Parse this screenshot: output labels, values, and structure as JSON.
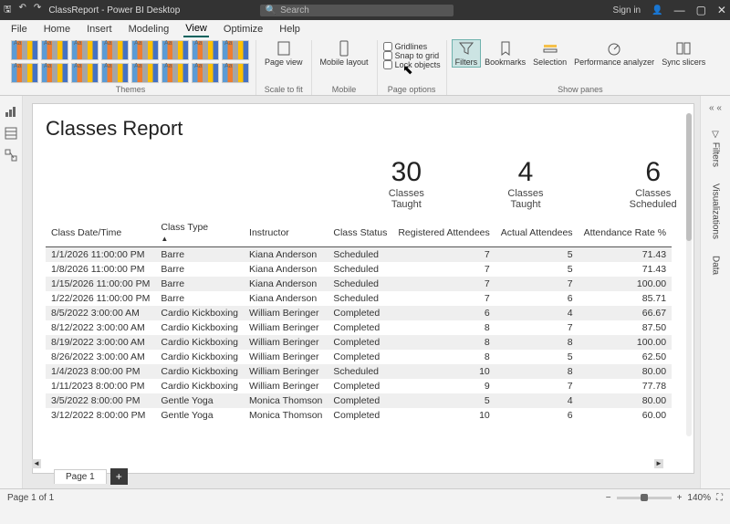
{
  "titlebar": {
    "title": "ClassReport - Power BI Desktop",
    "search_placeholder": "Search",
    "signin": "Sign in"
  },
  "menu": {
    "file": "File",
    "home": "Home",
    "insert": "Insert",
    "modeling": "Modeling",
    "view": "View",
    "optimize": "Optimize",
    "help": "Help"
  },
  "ribbon": {
    "themes_label": "Themes",
    "pageview": "Page view",
    "scale_label": "Scale to fit",
    "mobile": "Mobile layout",
    "mobile_label": "Mobile",
    "gridlines": "Gridlines",
    "snap": "Snap to grid",
    "lock": "Lock objects",
    "pageopts_label": "Page options",
    "filters": "Filters",
    "bookmarks": "Bookmarks",
    "selection": "Selection",
    "perf": "Performance analyzer",
    "sync": "Sync slicers",
    "panes_label": "Show panes"
  },
  "rightpanes": {
    "filters": "Filters",
    "visualizations": "Visualizations",
    "data": "Data"
  },
  "report": {
    "title": "Classes Report",
    "cards": [
      {
        "num": "30",
        "lbl": "Classes Taught"
      },
      {
        "num": "4",
        "lbl": "Classes Taught"
      },
      {
        "num": "6",
        "lbl": "Classes Scheduled"
      }
    ],
    "headers": {
      "dt": "Class Date/Time",
      "type": "Class Type",
      "instr": "Instructor",
      "status": "Class Status",
      "reg": "Registered Attendees",
      "act": "Actual Attendees",
      "rate": "Attendance Rate %"
    },
    "rows": [
      {
        "dt": "1/1/2026 11:00:00 PM",
        "type": "Barre",
        "instr": "Kiana Anderson",
        "status": "Scheduled",
        "reg": "7",
        "act": "5",
        "rate": "71.43"
      },
      {
        "dt": "1/8/2026 11:00:00 PM",
        "type": "Barre",
        "instr": "Kiana Anderson",
        "status": "Scheduled",
        "reg": "7",
        "act": "5",
        "rate": "71.43"
      },
      {
        "dt": "1/15/2026 11:00:00 PM",
        "type": "Barre",
        "instr": "Kiana Anderson",
        "status": "Scheduled",
        "reg": "7",
        "act": "7",
        "rate": "100.00"
      },
      {
        "dt": "1/22/2026 11:00:00 PM",
        "type": "Barre",
        "instr": "Kiana Anderson",
        "status": "Scheduled",
        "reg": "7",
        "act": "6",
        "rate": "85.71"
      },
      {
        "dt": "8/5/2022 3:00:00 AM",
        "type": "Cardio Kickboxing",
        "instr": "William Beringer",
        "status": "Completed",
        "reg": "6",
        "act": "4",
        "rate": "66.67"
      },
      {
        "dt": "8/12/2022 3:00:00 AM",
        "type": "Cardio Kickboxing",
        "instr": "William Beringer",
        "status": "Completed",
        "reg": "8",
        "act": "7",
        "rate": "87.50"
      },
      {
        "dt": "8/19/2022 3:00:00 AM",
        "type": "Cardio Kickboxing",
        "instr": "William Beringer",
        "status": "Completed",
        "reg": "8",
        "act": "8",
        "rate": "100.00"
      },
      {
        "dt": "8/26/2022 3:00:00 AM",
        "type": "Cardio Kickboxing",
        "instr": "William Beringer",
        "status": "Completed",
        "reg": "8",
        "act": "5",
        "rate": "62.50"
      },
      {
        "dt": "1/4/2023 8:00:00 PM",
        "type": "Cardio Kickboxing",
        "instr": "William Beringer",
        "status": "Scheduled",
        "reg": "10",
        "act": "8",
        "rate": "80.00"
      },
      {
        "dt": "1/11/2023 8:00:00 PM",
        "type": "Cardio Kickboxing",
        "instr": "William Beringer",
        "status": "Completed",
        "reg": "9",
        "act": "7",
        "rate": "77.78"
      },
      {
        "dt": "3/5/2022 8:00:00 PM",
        "type": "Gentle Yoga",
        "instr": "Monica Thomson",
        "status": "Completed",
        "reg": "5",
        "act": "4",
        "rate": "80.00"
      },
      {
        "dt": "3/12/2022 8:00:00 PM",
        "type": "Gentle Yoga",
        "instr": "Monica Thomson",
        "status": "Completed",
        "reg": "10",
        "act": "6",
        "rate": "60.00"
      }
    ]
  },
  "footer": {
    "pagetab": "Page 1",
    "pagecount": "Page 1 of 1",
    "zoom": "140%"
  }
}
